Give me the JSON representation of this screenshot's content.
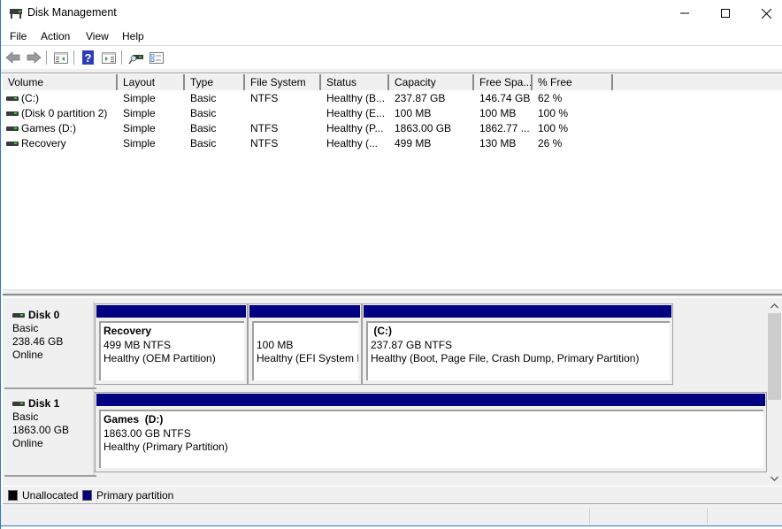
{
  "window": {
    "title": "Disk Management",
    "controls": {
      "minimize": "minimize",
      "maximize": "maximize",
      "close": "close"
    }
  },
  "menu": [
    {
      "label": "File"
    },
    {
      "label": "Action"
    },
    {
      "label": "View"
    },
    {
      "label": "Help"
    }
  ],
  "toolbar": [
    {
      "icon": "back-arrow-icon",
      "label": "Back"
    },
    {
      "icon": "forward-arrow-icon",
      "label": "Forward"
    },
    {
      "icon": "show-hide-console-tree-icon",
      "label": "Show/Hide Console Tree"
    },
    {
      "icon": "help-icon",
      "label": "Help"
    },
    {
      "icon": "show-hide-action-pane-icon",
      "label": "Show/Hide Action Pane"
    },
    {
      "icon": "connect-disk-icon",
      "label": "Connect"
    },
    {
      "icon": "properties-checklist-icon",
      "label": "Properties"
    }
  ],
  "volume_list": {
    "columns": [
      "Volume",
      "Layout",
      "Type",
      "File System",
      "Status",
      "Capacity",
      "Free Spa...",
      "% Free"
    ],
    "rows": [
      {
        "volume": " (C:)",
        "layout": "Simple",
        "type": "Basic",
        "fs": "NTFS",
        "status": "Healthy (B...",
        "capacity": "237.87 GB",
        "free": "146.74 GB",
        "pct": "62 %"
      },
      {
        "volume": "(Disk 0 partition 2)",
        "layout": "Simple",
        "type": "Basic",
        "fs": "",
        "status": "Healthy (E...",
        "capacity": "100 MB",
        "free": "100 MB",
        "pct": "100 %"
      },
      {
        "volume": "Games (D:)",
        "layout": "Simple",
        "type": "Basic",
        "fs": "NTFS",
        "status": "Healthy (P...",
        "capacity": "1863.00 GB",
        "free": "1862.77 ...",
        "pct": "100 %"
      },
      {
        "volume": "Recovery",
        "layout": "Simple",
        "type": "Basic",
        "fs": "NTFS",
        "status": "Healthy (...",
        "capacity": "499 MB",
        "free": "130 MB",
        "pct": "26 %"
      }
    ]
  },
  "disks": [
    {
      "name": "Disk 0",
      "type": "Basic",
      "size": "238.46 GB",
      "state": "Online",
      "partitions": [
        {
          "name": "Recovery",
          "size": "499 MB NTFS",
          "status": "Healthy (OEM Partition)"
        },
        {
          "name": "",
          "size": "100 MB",
          "status": "Healthy (EFI System P"
        },
        {
          "name": " (C:)",
          "size": "237.87 GB NTFS",
          "status": "Healthy (Boot, Page File, Crash Dump, Primary Partition)"
        }
      ]
    },
    {
      "name": "Disk 1",
      "type": "Basic",
      "size": "1863.00 GB",
      "state": "Online",
      "partitions": [
        {
          "name": "Games  (D:)",
          "size": "1863.00 GB NTFS",
          "status": "Healthy (Primary Partition)"
        }
      ]
    }
  ],
  "legend": [
    {
      "label": "Unallocated",
      "color": "#000000"
    },
    {
      "label": "Primary partition",
      "color": "#000080"
    }
  ],
  "colors": {
    "primary_partition": "#000080",
    "unallocated": "#000000",
    "window_border": "#2b79d0"
  }
}
